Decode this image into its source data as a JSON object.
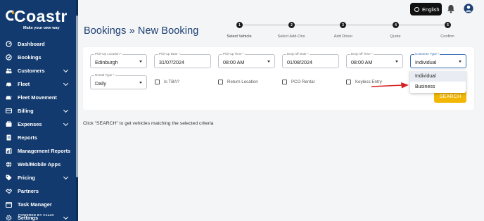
{
  "brand": {
    "name": "Coastr",
    "tagline": "Make your own way",
    "powered_by": "POWERED BY Coastr"
  },
  "sidebar": {
    "items": [
      {
        "label": "Dashboard",
        "icon": "dashboard-icon",
        "has_chevron": false
      },
      {
        "label": "Bookings",
        "icon": "bookings-icon",
        "has_chevron": false
      },
      {
        "label": "Customers",
        "icon": "customers-icon",
        "has_chevron": true
      },
      {
        "label": "Fleet",
        "icon": "car-icon",
        "has_chevron": true
      },
      {
        "label": "Fleet Movement",
        "icon": "fleet-movement-icon",
        "has_chevron": false
      },
      {
        "label": "Billing",
        "icon": "billing-icon",
        "has_chevron": true
      },
      {
        "label": "Expenses",
        "icon": "expenses-icon",
        "has_chevron": true
      },
      {
        "label": "Reports",
        "icon": "reports-icon",
        "has_chevron": false
      },
      {
        "label": "Management Reports",
        "icon": "management-reports-icon",
        "has_chevron": false
      },
      {
        "label": "Web/Mobile Apps",
        "icon": "globe-icon",
        "has_chevron": false
      },
      {
        "label": "Pricing",
        "icon": "tag-icon",
        "has_chevron": true
      },
      {
        "label": "Partners",
        "icon": "handshake-icon",
        "has_chevron": false
      },
      {
        "label": "Task Manager",
        "icon": "calendar-icon",
        "has_chevron": false
      },
      {
        "label": "Settings",
        "icon": "gear-icon",
        "has_chevron": true
      }
    ]
  },
  "topbar": {
    "language": "English"
  },
  "page": {
    "title": "Bookings » New  Booking"
  },
  "stepper": {
    "steps": [
      {
        "num": "1",
        "label": "Select Vehicle",
        "active": true
      },
      {
        "num": "2",
        "label": "Select Add-Ons",
        "active": false
      },
      {
        "num": "3",
        "label": "Add Driver",
        "active": false
      },
      {
        "num": "4",
        "label": "Quote",
        "active": false
      },
      {
        "num": "5",
        "label": "Confirm",
        "active": false
      }
    ]
  },
  "form": {
    "pickup_location": {
      "label": "Pick-Up Location *",
      "value": "Edinburgh"
    },
    "pickup_date": {
      "label": "Pick-up Date *",
      "value": "31/07/2024"
    },
    "pickup_time": {
      "label": "Pick-up Time *",
      "value": "08:00 AM"
    },
    "dropoff_date": {
      "label": "Drop-off Date *",
      "value": "01/08/2024"
    },
    "dropoff_time": {
      "label": "Drop-off Time *",
      "value": "08:00 AM"
    },
    "customer_type": {
      "label": "Customer Type *",
      "value": "Individual",
      "options": [
        "Individual",
        "Business"
      ]
    },
    "rental_type": {
      "label": "Rental Type *",
      "value": "Daily"
    },
    "checkboxes": {
      "tba": "Is TBA?",
      "return_location": "Return Location",
      "pco": "PCO Rental",
      "keyless": "Keyless Entry"
    },
    "search_label": "SEARCH"
  },
  "hint": "Click \"SEARCH\" to get vehicles matching the selected criteria",
  "colors": {
    "sidebar": "#123a6e",
    "accent": "#1b3f73",
    "search": "#f2b705",
    "arrow": "#d62020"
  }
}
